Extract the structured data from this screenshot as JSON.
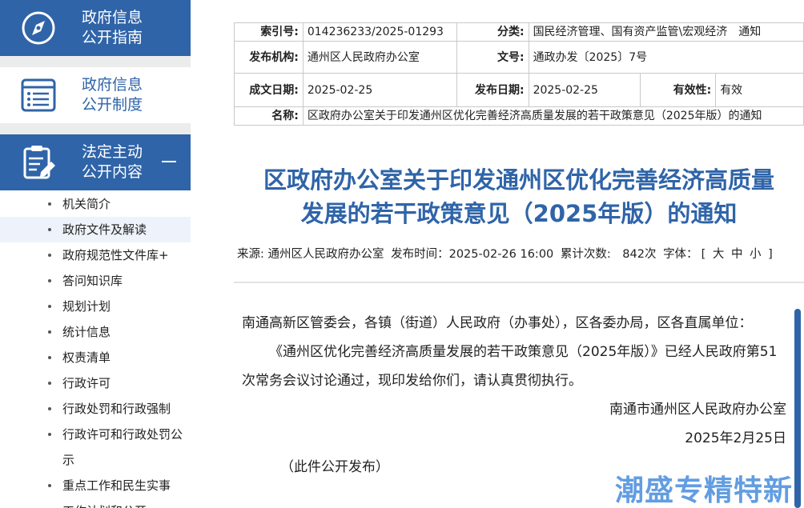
{
  "sidebar": {
    "blocks": [
      {
        "label_line1": "政府信息",
        "label_line2": "公开指南",
        "icon": "compass-icon"
      },
      {
        "label_line1": "政府信息",
        "label_line2": "公开制度",
        "icon": "list-document-icon"
      },
      {
        "label_line1": "法定主动",
        "label_line2": "公开内容",
        "icon": "clipboard-edit-icon"
      }
    ],
    "items": [
      "机关简介",
      "政府文件及解读",
      "政府规范性文件库+",
      "答问知识库",
      "规划计划",
      "统计信息",
      "权责清单",
      "行政许可",
      "行政处罚和行政强制",
      "行政许可和行政处罚公示",
      "重点工作和民生实事",
      "工作计划和公开"
    ]
  },
  "meta": {
    "index_label": "索引号:",
    "index_value": "014236233/2025-01293",
    "category_label": "分类:",
    "category_value": "国民经济管理、国有资产监管\\宏观经济　通知",
    "issuer_label": "发布机构:",
    "issuer_value": "通州区人民政府办公室",
    "docno_label": "文号:",
    "docno_value": "通政办发〔2025〕7号",
    "created_label": "成文日期:",
    "created_value": "2025-02-25",
    "published_label": "发布日期:",
    "published_value": "2025-02-25",
    "validity_label": "有效性:",
    "validity_value": "有效",
    "name_label": "名称:",
    "name_value": "区政府办公室关于印发通州区优化完善经济高质量发展的若干政策意见（2025年版）的通知"
  },
  "article": {
    "title_line1": "区政府办公室关于印发通州区优化完善经济高质量",
    "title_line2": "发展的若干政策意见（2025年版）的通知",
    "source": "来源: 通州区人民政府办公室",
    "publish_time": "发布时间：2025-02-26 16:00",
    "views": "累计次数:　842次",
    "font_label": "字体：",
    "font_sizes": "[ 大 中 小 ]",
    "addressee": "南通高新区管委会，各镇（街道）人民政府（办事处），区各委办局，区各直属单位：",
    "paragraph": "《通州区优化完善经济高质量发展的若干政策意见（2025年版）》已经人民政府第51次常务会议讨论通过，现印发给你们，请认真贯彻执行。",
    "signature": "南通市通州区人民政府办公室",
    "sign_date": "2025年2月25日",
    "note": "（此件公开发布）"
  },
  "watermark": "潮盛专精特新",
  "colors": {
    "accent": "#2f64a8",
    "separator": "#ececec"
  }
}
